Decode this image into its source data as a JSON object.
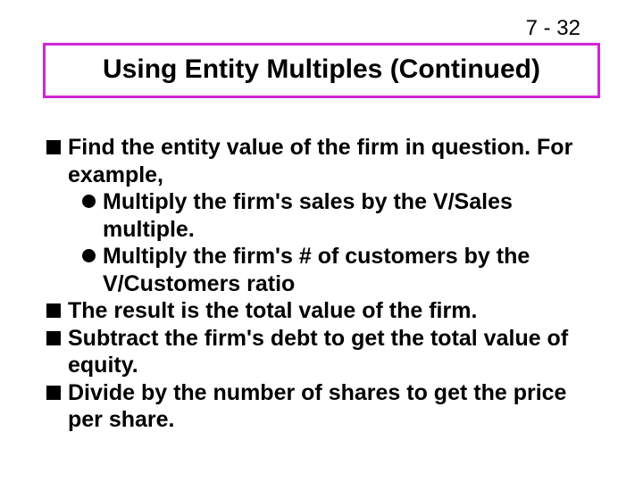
{
  "page_number": "7 - 32",
  "title": "Using Entity Multiples (Continued)",
  "bullets": {
    "b1": "Find the entity value of the firm in question. For example,",
    "b1s1": "Multiply the firm's sales by the V/Sales multiple.",
    "b1s2": "Multiply the firm's # of customers by the V/Customers ratio",
    "b2": "The result is the total value of the firm.",
    "b3": "Subtract the firm's debt to get the total value of equity.",
    "b4": "Divide by the number of shares to get the price per share."
  }
}
